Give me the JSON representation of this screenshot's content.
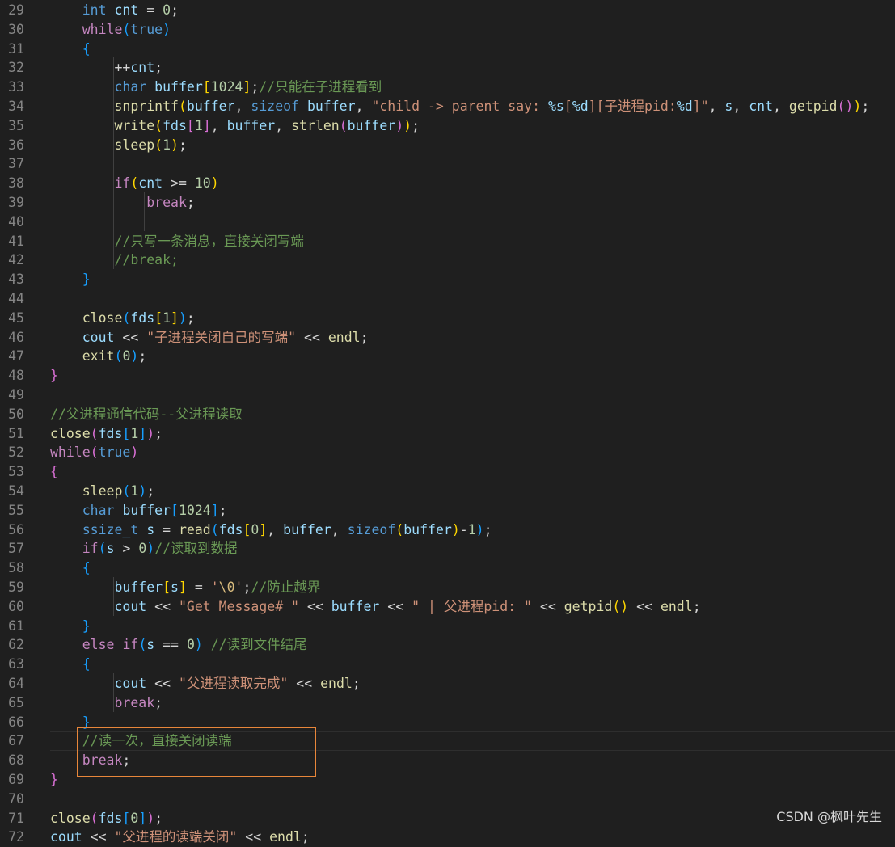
{
  "editor": {
    "first_line_number": 29,
    "lines": [
      [
        [
          "    ",
          "pl"
        ],
        [
          "int",
          "kw"
        ],
        [
          " ",
          "pl"
        ],
        [
          "cnt",
          "var"
        ],
        [
          " = ",
          "pl"
        ],
        [
          "0",
          "num"
        ],
        [
          ";",
          "pl"
        ]
      ],
      [
        [
          "    ",
          "pl"
        ],
        [
          "while",
          "ctl"
        ],
        [
          "(",
          "b3"
        ],
        [
          "true",
          "kw"
        ],
        [
          ")",
          "b3"
        ]
      ],
      [
        [
          "    ",
          "pl"
        ],
        [
          "{",
          "b3"
        ]
      ],
      [
        [
          "        ",
          "pl"
        ],
        [
          "++",
          "pl"
        ],
        [
          "cnt",
          "var"
        ],
        [
          ";",
          "pl"
        ]
      ],
      [
        [
          "        ",
          "pl"
        ],
        [
          "char",
          "kw"
        ],
        [
          " ",
          "pl"
        ],
        [
          "buffer",
          "var"
        ],
        [
          "[",
          "b1"
        ],
        [
          "1024",
          "num"
        ],
        [
          "]",
          "b1"
        ],
        [
          ";",
          "pl"
        ],
        [
          "//只能在子进程看到",
          "cmt"
        ]
      ],
      [
        [
          "        ",
          "pl"
        ],
        [
          "snprintf",
          "fn"
        ],
        [
          "(",
          "b1"
        ],
        [
          "buffer",
          "var"
        ],
        [
          ", ",
          "pl"
        ],
        [
          "sizeof",
          "kw"
        ],
        [
          " ",
          "pl"
        ],
        [
          "buffer",
          "var"
        ],
        [
          ", ",
          "pl"
        ],
        [
          "\"child -> parent say: ",
          "str"
        ],
        [
          "%s",
          "var"
        ],
        [
          "[",
          "str"
        ],
        [
          "%d",
          "var"
        ],
        [
          "][子进程pid:",
          "str"
        ],
        [
          "%d",
          "var"
        ],
        [
          "]\"",
          "str"
        ],
        [
          ", ",
          "pl"
        ],
        [
          "s",
          "var"
        ],
        [
          ", ",
          "pl"
        ],
        [
          "cnt",
          "var"
        ],
        [
          ", ",
          "pl"
        ],
        [
          "getpid",
          "fn"
        ],
        [
          "()",
          "b2"
        ],
        [
          ")",
          "b1"
        ],
        [
          ";",
          "pl"
        ]
      ],
      [
        [
          "        ",
          "pl"
        ],
        [
          "write",
          "fn"
        ],
        [
          "(",
          "b1"
        ],
        [
          "fds",
          "var"
        ],
        [
          "[",
          "b2"
        ],
        [
          "1",
          "num"
        ],
        [
          "]",
          "b2"
        ],
        [
          ", ",
          "pl"
        ],
        [
          "buffer",
          "var"
        ],
        [
          ", ",
          "pl"
        ],
        [
          "strlen",
          "fn"
        ],
        [
          "(",
          "b2"
        ],
        [
          "buffer",
          "var"
        ],
        [
          ")",
          "b2"
        ],
        [
          ")",
          "b1"
        ],
        [
          ";",
          "pl"
        ]
      ],
      [
        [
          "        ",
          "pl"
        ],
        [
          "sleep",
          "fn"
        ],
        [
          "(",
          "b1"
        ],
        [
          "1",
          "num"
        ],
        [
          ")",
          "b1"
        ],
        [
          ";",
          "pl"
        ]
      ],
      [
        [
          "",
          "pl"
        ]
      ],
      [
        [
          "        ",
          "pl"
        ],
        [
          "if",
          "ctl"
        ],
        [
          "(",
          "b1"
        ],
        [
          "cnt",
          "var"
        ],
        [
          " >= ",
          "pl"
        ],
        [
          "10",
          "num"
        ],
        [
          ")",
          "b1"
        ]
      ],
      [
        [
          "            ",
          "pl"
        ],
        [
          "break",
          "ctl"
        ],
        [
          ";",
          "pl"
        ]
      ],
      [
        [
          "",
          "pl"
        ]
      ],
      [
        [
          "        ",
          "pl"
        ],
        [
          "//只写一条消息，直接关闭写端",
          "cmt"
        ]
      ],
      [
        [
          "        ",
          "pl"
        ],
        [
          "//break;",
          "cmt"
        ]
      ],
      [
        [
          "    ",
          "pl"
        ],
        [
          "}",
          "b3"
        ]
      ],
      [
        [
          "",
          "pl"
        ]
      ],
      [
        [
          "    ",
          "pl"
        ],
        [
          "close",
          "fn"
        ],
        [
          "(",
          "b3"
        ],
        [
          "fds",
          "var"
        ],
        [
          "[",
          "b1"
        ],
        [
          "1",
          "num"
        ],
        [
          "]",
          "b1"
        ],
        [
          ")",
          "b3"
        ],
        [
          ";",
          "pl"
        ]
      ],
      [
        [
          "    ",
          "pl"
        ],
        [
          "cout",
          "var"
        ],
        [
          " << ",
          "pl"
        ],
        [
          "\"子进程关闭自己的写端\"",
          "str"
        ],
        [
          " << ",
          "pl"
        ],
        [
          "endl",
          "fn"
        ],
        [
          ";",
          "pl"
        ]
      ],
      [
        [
          "    ",
          "pl"
        ],
        [
          "exit",
          "fn"
        ],
        [
          "(",
          "b3"
        ],
        [
          "0",
          "num"
        ],
        [
          ")",
          "b3"
        ],
        [
          ";",
          "pl"
        ]
      ],
      [
        [
          "",
          "pl"
        ],
        [
          "}",
          "b2"
        ]
      ],
      [
        [
          "",
          "pl"
        ]
      ],
      [
        [
          "",
          "pl"
        ],
        [
          "//父进程通信代码--父进程读取",
          "cmt"
        ]
      ],
      [
        [
          "",
          "pl"
        ],
        [
          "close",
          "fn"
        ],
        [
          "(",
          "b2"
        ],
        [
          "fds",
          "var"
        ],
        [
          "[",
          "b3"
        ],
        [
          "1",
          "num"
        ],
        [
          "]",
          "b3"
        ],
        [
          ")",
          "b2"
        ],
        [
          ";",
          "pl"
        ]
      ],
      [
        [
          "",
          "pl"
        ],
        [
          "while",
          "ctl"
        ],
        [
          "(",
          "b2"
        ],
        [
          "true",
          "kw"
        ],
        [
          ")",
          "b2"
        ]
      ],
      [
        [
          "",
          "pl"
        ],
        [
          "{",
          "b2"
        ]
      ],
      [
        [
          "    ",
          "pl"
        ],
        [
          "sleep",
          "fn"
        ],
        [
          "(",
          "b3"
        ],
        [
          "1",
          "num"
        ],
        [
          ")",
          "b3"
        ],
        [
          ";",
          "pl"
        ]
      ],
      [
        [
          "    ",
          "pl"
        ],
        [
          "char",
          "kw"
        ],
        [
          " ",
          "pl"
        ],
        [
          "buffer",
          "var"
        ],
        [
          "[",
          "b3"
        ],
        [
          "1024",
          "num"
        ],
        [
          "]",
          "b3"
        ],
        [
          ";",
          "pl"
        ]
      ],
      [
        [
          "    ",
          "pl"
        ],
        [
          "ssize_t",
          "kw"
        ],
        [
          " ",
          "pl"
        ],
        [
          "s",
          "var"
        ],
        [
          " = ",
          "pl"
        ],
        [
          "read",
          "fn"
        ],
        [
          "(",
          "b3"
        ],
        [
          "fds",
          "var"
        ],
        [
          "[",
          "b1"
        ],
        [
          "0",
          "num"
        ],
        [
          "]",
          "b1"
        ],
        [
          ", ",
          "pl"
        ],
        [
          "buffer",
          "var"
        ],
        [
          ", ",
          "pl"
        ],
        [
          "sizeof",
          "kw"
        ],
        [
          "(",
          "b1"
        ],
        [
          "buffer",
          "var"
        ],
        [
          ")",
          "b1"
        ],
        [
          "-",
          "pl"
        ],
        [
          "1",
          "num"
        ],
        [
          ")",
          "b3"
        ],
        [
          ";",
          "pl"
        ]
      ],
      [
        [
          "    ",
          "pl"
        ],
        [
          "if",
          "ctl"
        ],
        [
          "(",
          "b3"
        ],
        [
          "s",
          "var"
        ],
        [
          " > ",
          "pl"
        ],
        [
          "0",
          "num"
        ],
        [
          ")",
          "b3"
        ],
        [
          "//读取到数据",
          "cmt"
        ]
      ],
      [
        [
          "    ",
          "pl"
        ],
        [
          "{",
          "b3"
        ]
      ],
      [
        [
          "        ",
          "pl"
        ],
        [
          "buffer",
          "var"
        ],
        [
          "[",
          "b1"
        ],
        [
          "s",
          "var"
        ],
        [
          "]",
          "b1"
        ],
        [
          " = ",
          "pl"
        ],
        [
          "'",
          "str"
        ],
        [
          "\\0",
          "esc"
        ],
        [
          "'",
          "str"
        ],
        [
          ";",
          "pl"
        ],
        [
          "//防止越界",
          "cmt"
        ]
      ],
      [
        [
          "        ",
          "pl"
        ],
        [
          "cout",
          "var"
        ],
        [
          " << ",
          "pl"
        ],
        [
          "\"Get Message# \"",
          "str"
        ],
        [
          " << ",
          "pl"
        ],
        [
          "buffer",
          "var"
        ],
        [
          " << ",
          "pl"
        ],
        [
          "\" | 父进程pid: \"",
          "str"
        ],
        [
          " << ",
          "pl"
        ],
        [
          "getpid",
          "fn"
        ],
        [
          "()",
          "b1"
        ],
        [
          " << ",
          "pl"
        ],
        [
          "endl",
          "fn"
        ],
        [
          ";",
          "pl"
        ]
      ],
      [
        [
          "    ",
          "pl"
        ],
        [
          "}",
          "b3"
        ]
      ],
      [
        [
          "    ",
          "pl"
        ],
        [
          "else",
          "ctl"
        ],
        [
          " ",
          "pl"
        ],
        [
          "if",
          "ctl"
        ],
        [
          "(",
          "b3"
        ],
        [
          "s",
          "var"
        ],
        [
          " == ",
          "pl"
        ],
        [
          "0",
          "num"
        ],
        [
          ")",
          "b3"
        ],
        [
          " ",
          "pl"
        ],
        [
          "//读到文件结尾",
          "cmt"
        ]
      ],
      [
        [
          "    ",
          "pl"
        ],
        [
          "{",
          "b3"
        ]
      ],
      [
        [
          "        ",
          "pl"
        ],
        [
          "cout",
          "var"
        ],
        [
          " << ",
          "pl"
        ],
        [
          "\"父进程读取完成\"",
          "str"
        ],
        [
          " << ",
          "pl"
        ],
        [
          "endl",
          "fn"
        ],
        [
          ";",
          "pl"
        ]
      ],
      [
        [
          "        ",
          "pl"
        ],
        [
          "break",
          "ctl"
        ],
        [
          ";",
          "pl"
        ]
      ],
      [
        [
          "    ",
          "pl"
        ],
        [
          "}",
          "b3"
        ]
      ],
      [
        [
          "    ",
          "pl"
        ],
        [
          "//读一次，直接关闭读端",
          "cmt"
        ]
      ],
      [
        [
          "    ",
          "pl"
        ],
        [
          "break",
          "ctl"
        ],
        [
          ";",
          "pl"
        ]
      ],
      [
        [
          "",
          "pl"
        ],
        [
          "}",
          "b2"
        ]
      ],
      [
        [
          "",
          "pl"
        ]
      ],
      [
        [
          "",
          "pl"
        ],
        [
          "close",
          "fn"
        ],
        [
          "(",
          "b2"
        ],
        [
          "fds",
          "var"
        ],
        [
          "[",
          "b3"
        ],
        [
          "0",
          "num"
        ],
        [
          "]",
          "b3"
        ],
        [
          ")",
          "b2"
        ],
        [
          ";",
          "pl"
        ]
      ],
      [
        [
          "",
          "pl"
        ],
        [
          "cout",
          "var"
        ],
        [
          " << ",
          "pl"
        ],
        [
          "\"父进程的读端关闭\"",
          "str"
        ],
        [
          " << ",
          "pl"
        ],
        [
          "endl",
          "fn"
        ],
        [
          ";",
          "pl"
        ]
      ]
    ]
  },
  "watermark": "CSDN @枫叶先生",
  "colors": {
    "background": "#1f1f1f",
    "line_number": "#858585",
    "keyword": "#569cd6",
    "control": "#c586c0",
    "function": "#dcdcaa",
    "variable": "#9cdcfe",
    "string": "#ce9178",
    "number": "#b5cea8",
    "comment": "#6a9955",
    "highlight_box": "#e8863a"
  }
}
